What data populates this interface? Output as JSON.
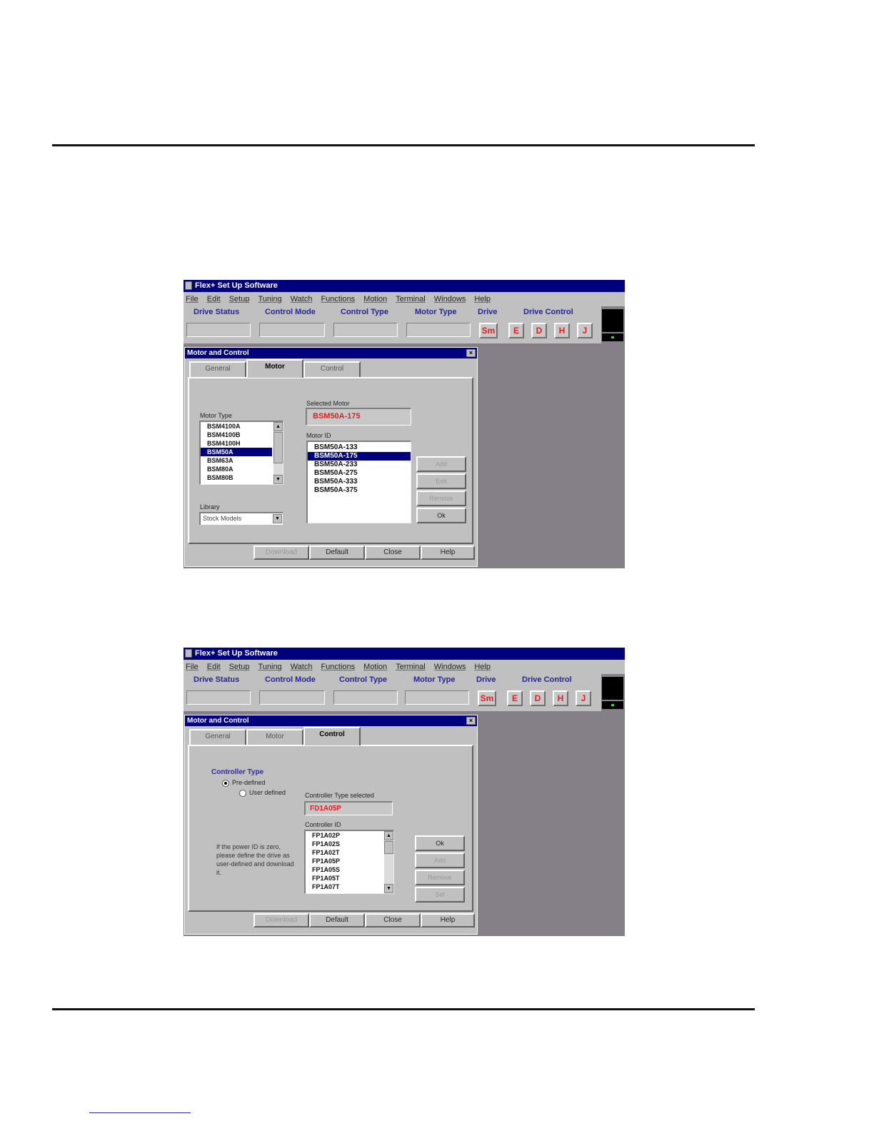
{
  "window_title": "Flex+ Set Up Software",
  "menu": [
    "File",
    "Edit",
    "Setup",
    "Tuning",
    "Watch",
    "Functions",
    "Motion",
    "Terminal",
    "Windows",
    "Help"
  ],
  "toolbar": {
    "labels": [
      "Drive Status",
      "Control Mode",
      "Control Type",
      "Motor Type",
      "Drive",
      "Drive Control"
    ],
    "drive_button": "Sm",
    "control_buttons": [
      "E",
      "D",
      "H",
      "J"
    ]
  },
  "dialog_title": "Motor and Control",
  "tabs": [
    "General",
    "Motor",
    "Control"
  ],
  "motor_screen": {
    "motor_type_label": "Motor Type",
    "motor_types": [
      "BSM4100A",
      "BSM4100B",
      "BSM4100H",
      "BSM50A",
      "BSM63A",
      "BSM80A",
      "BSM80B"
    ],
    "motor_type_selected": "BSM50A",
    "library_label": "Library",
    "library_value": "Stock Models",
    "selected_motor_label": "Selected Motor",
    "selected_motor": "BSM50A-175",
    "motor_id_label": "Motor ID",
    "motor_ids": [
      "BSM50A-133",
      "BSM50A-175",
      "BSM50A-233",
      "BSM50A-275",
      "BSM50A-333",
      "BSM50A-375"
    ],
    "motor_id_selected": "BSM50A-175",
    "side_buttons": [
      "Add",
      "Edit",
      "Remove",
      "Ok"
    ]
  },
  "control_screen": {
    "group_label": "Controller Type",
    "radio_predefined": "Pre-defined",
    "radio_userdefined": "User defined",
    "type_selected_label": "Controller Type selected",
    "type_selected_value": "FD1A05P",
    "controller_id_label": "Controller ID",
    "controller_ids": [
      "FP1A02P",
      "FP1A02S",
      "FP1A02T",
      "FP1A05P",
      "FP1A05S",
      "FP1A05T",
      "FP1A07T"
    ],
    "hint": "If the power ID is zero, please define the drive as user-defined and download it.",
    "side_buttons": [
      "Ok",
      "Add",
      "Remove",
      "Sel"
    ]
  },
  "bottom_buttons": [
    "Download",
    "Default",
    "Close",
    "Help"
  ]
}
